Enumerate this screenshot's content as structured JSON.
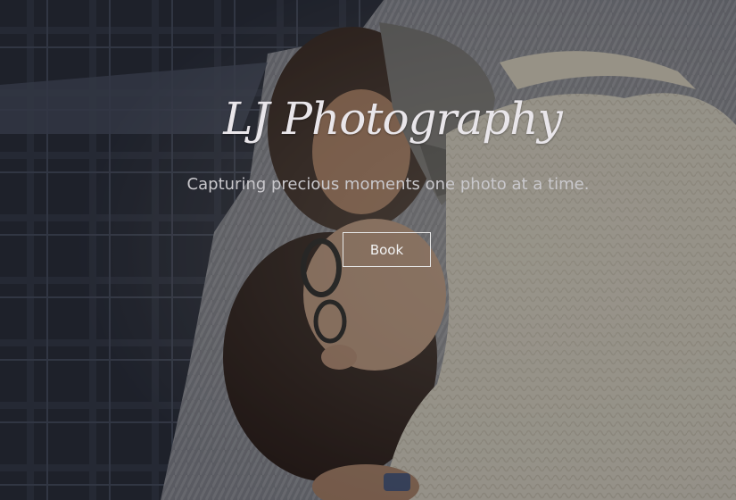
{
  "hero": {
    "title": "LJ Photography",
    "tagline": "Capturing precious moments one photo at a time.",
    "book_label": "Book"
  }
}
